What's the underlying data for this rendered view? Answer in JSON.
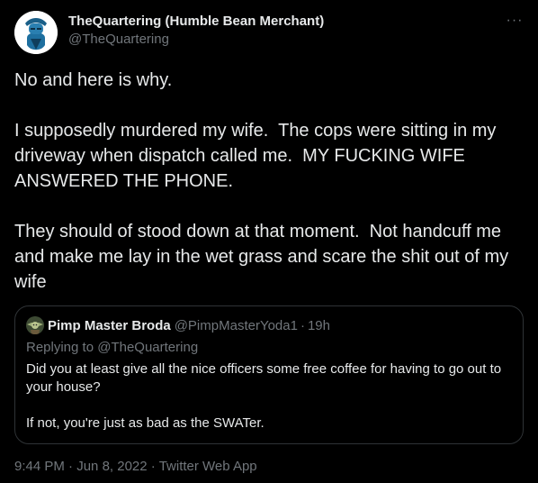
{
  "author": {
    "display_name": "TheQuartering (Humble Bean Merchant)",
    "handle": "@TheQuartering",
    "avatar_icon": "bearded-man-avatar-icon"
  },
  "more_icon": "more-options-icon",
  "tweet": {
    "paragraphs": [
      "No and here is why.",
      "I supposedly murdered my wife.  The cops were sitting in my driveway when dispatch called me.  MY FUCKING WIFE ANSWERED THE PHONE.",
      "They should of stood down at that moment.  Not handcuff me and make me lay in the wet grass and scare the shit out of my wife"
    ]
  },
  "quote": {
    "display_name": "Pimp Master Broda",
    "handle": "@PimpMasterYoda1",
    "separator": "·",
    "time": "19h",
    "replying_to": "Replying to @TheQuartering",
    "paragraphs": [
      "Did you at least give all the nice officers some free coffee for having to go out to your house?",
      "If not, you're just as bad as the SWATer."
    ]
  },
  "meta": {
    "time": "9:44 PM",
    "separator": "·",
    "date": "Jun 8, 2022",
    "source": "Twitter Web App"
  },
  "colors": {
    "background": "#000000",
    "text": "#e7e9ea",
    "secondary": "#71767b",
    "border": "#2f3336"
  }
}
